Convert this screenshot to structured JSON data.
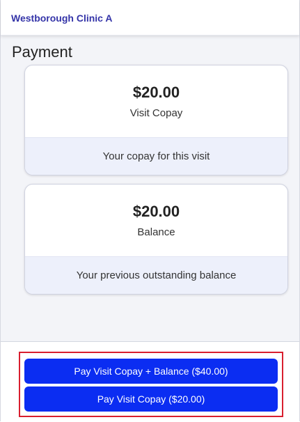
{
  "header": {
    "clinic_name": "Westborough Clinic A"
  },
  "main": {
    "section_title": "Payment",
    "cards": [
      {
        "amount": "$20.00",
        "label": "Visit Copay",
        "description": "Your copay for this visit"
      },
      {
        "amount": "$20.00",
        "label": "Balance",
        "description": "Your previous outstanding balance"
      }
    ]
  },
  "footer": {
    "buttons": [
      {
        "label": "Pay Visit Copay + Balance ($40.00)"
      },
      {
        "label": "Pay Visit Copay ($20.00)"
      }
    ],
    "highlight_color": "#d81e2e",
    "button_color": "#0b2df2"
  }
}
